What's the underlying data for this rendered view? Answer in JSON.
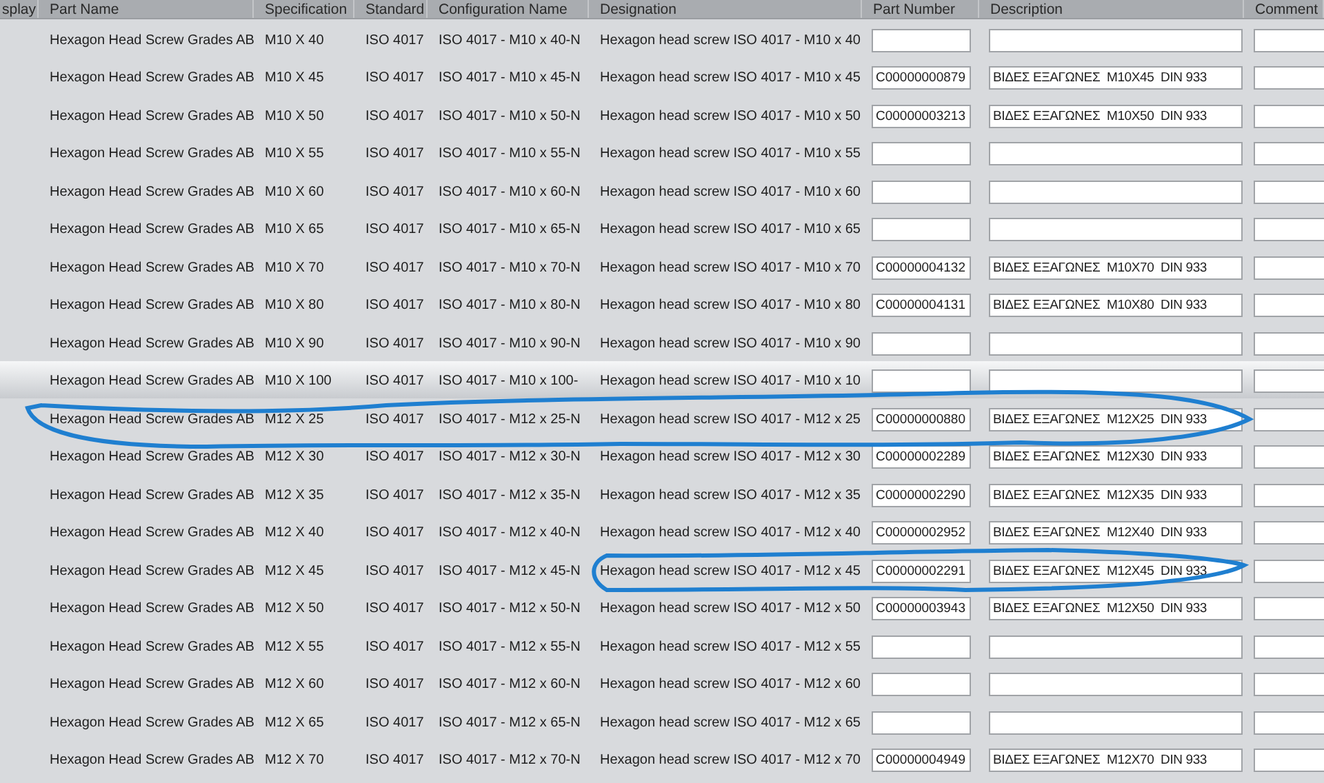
{
  "table": {
    "columns": [
      "splay",
      "Part Name",
      "Specification",
      "Standard",
      "Configuration Name",
      "Designation",
      "Part Number",
      "Description",
      "Comment"
    ],
    "rows": [
      {
        "kind": "plain",
        "part_name": "Hexagon Head Screw Grades AB",
        "specification": "M10 X 40",
        "standard": "ISO 4017",
        "configuration_name": "ISO 4017 - M10 x 40-N",
        "designation": "Hexagon head screw ISO 4017 - M10 x 40",
        "selected": false
      },
      {
        "kind": "plain",
        "part_name": "Hexagon Head Screw Grades AB",
        "specification": "M10 X 45",
        "standard": "ISO 4017",
        "configuration_name": "ISO 4017 - M10 x 45-N",
        "designation": "Hexagon head screw ISO 4017 - M10 x 45",
        "part_number": "C00000000879",
        "description": "ΒΙΔΕΣ ΕΞΑΓΩΝΕΣ  M10X45  DIN 933",
        "selected": false
      },
      {
        "kind": "plain",
        "part_name": "Hexagon Head Screw Grades AB",
        "specification": "M10 X 50",
        "standard": "ISO 4017",
        "configuration_name": "ISO 4017 - M10 x 50-N",
        "designation": "Hexagon head screw ISO 4017 - M10 x 50",
        "part_number": "C00000003213",
        "description": "ΒΙΔΕΣ ΕΞΑΓΩΝΕΣ  M10X50  DIN 933",
        "selected": false
      },
      {
        "kind": "plain",
        "part_name": "Hexagon Head Screw Grades AB",
        "specification": "M10 X 55",
        "standard": "ISO 4017",
        "configuration_name": "ISO 4017 - M10 x 55-N",
        "designation": "Hexagon head screw ISO 4017 - M10 x 55",
        "selected": false
      },
      {
        "kind": "plain",
        "part_name": "Hexagon Head Screw Grades AB",
        "specification": "M10 X 60",
        "standard": "ISO 4017",
        "configuration_name": "ISO 4017 - M10 x 60-N",
        "designation": "Hexagon head screw ISO 4017 - M10 x 60",
        "selected": false
      },
      {
        "kind": "plain",
        "part_name": "Hexagon Head Screw Grades AB",
        "specification": "M10 X 65",
        "standard": "ISO 4017",
        "configuration_name": "ISO 4017 - M10 x 65-N",
        "designation": "Hexagon head screw ISO 4017 - M10 x 65",
        "selected": false
      },
      {
        "kind": "plain",
        "part_name": "Hexagon Head Screw Grades AB",
        "specification": "M10 X 70",
        "standard": "ISO 4017",
        "configuration_name": "ISO 4017 - M10 x 70-N",
        "designation": "Hexagon head screw ISO 4017 - M10 x 70",
        "part_number": "C00000004132",
        "description": "ΒΙΔΕΣ ΕΞΑΓΩΝΕΣ  M10X70  DIN 933",
        "selected": false
      },
      {
        "kind": "plain",
        "part_name": "Hexagon Head Screw Grades AB",
        "specification": "M10 X 80",
        "standard": "ISO 4017",
        "configuration_name": "ISO 4017 - M10 x 80-N",
        "designation": "Hexagon head screw ISO 4017 - M10 x 80",
        "part_number": "C00000004131",
        "description": "ΒΙΔΕΣ ΕΞΑΓΩΝΕΣ  M10X80  DIN 933",
        "selected": false
      },
      {
        "kind": "plain",
        "part_name": "Hexagon Head Screw Grades AB",
        "specification": "M10 X 90",
        "standard": "ISO 4017",
        "configuration_name": "ISO 4017 - M10 x 90-N",
        "designation": "Hexagon head screw ISO 4017 - M10 x 90",
        "selected": false
      },
      {
        "kind": "plain",
        "part_name": "Hexagon Head Screw Grades AB",
        "specification": "M10 X 100",
        "standard": "ISO 4017",
        "configuration_name": "ISO 4017 - M10 x 100-",
        "designation": "Hexagon head screw ISO 4017 - M10 x 10",
        "selected": true
      },
      {
        "kind": "circled",
        "part_name": "Hexagon Head Screw Grades AB",
        "specification": "M12 X 25",
        "standard": "ISO 4017",
        "configuration_name": "ISO 4017 - M12 x 25-N",
        "designation": "Hexagon head screw ISO 4017 - M12 x 25",
        "part_number": "C00000000880",
        "description": "ΒΙΔΕΣ ΕΞΑΓΩΝΕΣ  M12X25  DIN 933",
        "selected": false
      },
      {
        "kind": "plain",
        "part_name": "Hexagon Head Screw Grades AB",
        "specification": "M12 X 30",
        "standard": "ISO 4017",
        "configuration_name": "ISO 4017 - M12 x 30-N",
        "designation": "Hexagon head screw ISO 4017 - M12 x 30",
        "part_number": "C00000002289",
        "description": "ΒΙΔΕΣ ΕΞΑΓΩΝΕΣ  M12X30  DIN 933",
        "selected": false
      },
      {
        "kind": "plain",
        "part_name": "Hexagon Head Screw Grades AB",
        "specification": "M12 X 35",
        "standard": "ISO 4017",
        "configuration_name": "ISO 4017 - M12 x 35-N",
        "designation": "Hexagon head screw ISO 4017 - M12 x 35",
        "part_number": "C00000002290",
        "description": "ΒΙΔΕΣ ΕΞΑΓΩΝΕΣ  M12X35  DIN 933",
        "selected": false
      },
      {
        "kind": "plain",
        "part_name": "Hexagon Head Screw Grades AB",
        "specification": "M12 X 40",
        "standard": "ISO 4017",
        "configuration_name": "ISO 4017 - M12 x 40-N",
        "designation": "Hexagon head screw ISO 4017 - M12 x 40",
        "part_number": "C00000002952",
        "description": "ΒΙΔΕΣ ΕΞΑΓΩΝΕΣ  M12X40  DIN 933",
        "selected": false
      },
      {
        "kind": "half-circled",
        "part_name": "Hexagon Head Screw Grades AB",
        "specification": "M12 X 45",
        "standard": "ISO 4017",
        "configuration_name": "ISO 4017 - M12 x 45-N",
        "designation": "Hexagon head screw ISO 4017 - M12 x 45",
        "part_number": "C00000002291",
        "description": "ΒΙΔΕΣ ΕΞΑΓΩΝΕΣ  M12X45  DIN 933",
        "selected": false
      },
      {
        "kind": "plain",
        "part_name": "Hexagon Head Screw Grades AB",
        "specification": "M12 X 50",
        "standard": "ISO 4017",
        "configuration_name": "ISO 4017 - M12 x 50-N",
        "designation": "Hexagon head screw ISO 4017 - M12 x 50",
        "part_number": "C00000003943",
        "description": "ΒΙΔΕΣ ΕΞΑΓΩΝΕΣ  M12X50  DIN 933",
        "selected": false
      },
      {
        "kind": "plain",
        "part_name": "Hexagon Head Screw Grades AB",
        "specification": "M12 X 55",
        "standard": "ISO 4017",
        "configuration_name": "ISO 4017 - M12 x 55-N",
        "designation": "Hexagon head screw ISO 4017 - M12 x 55",
        "selected": false
      },
      {
        "kind": "plain",
        "part_name": "Hexagon Head Screw Grades AB",
        "specification": "M12 X 60",
        "standard": "ISO 4017",
        "configuration_name": "ISO 4017 - M12 x 60-N",
        "designation": "Hexagon head screw ISO 4017 - M12 x 60",
        "selected": false
      },
      {
        "kind": "plain",
        "part_name": "Hexagon Head Screw Grades AB",
        "specification": "M12 X 65",
        "standard": "ISO 4017",
        "configuration_name": "ISO 4017 - M12 x 65-N",
        "designation": "Hexagon head screw ISO 4017 - M12 x 65",
        "selected": false
      },
      {
        "kind": "plain",
        "part_name": "Hexagon Head Screw Grades AB",
        "specification": "M12 X 70",
        "standard": "ISO 4017",
        "configuration_name": "ISO 4017 - M12 x 70-N",
        "designation": "Hexagon head screw ISO 4017 - M12 x 70",
        "part_number": "C00000004949",
        "description": "ΒΙΔΕΣ ΕΞΑΓΩΝΕΣ  M12X70  DIN 933",
        "selected": false
      }
    ]
  }
}
